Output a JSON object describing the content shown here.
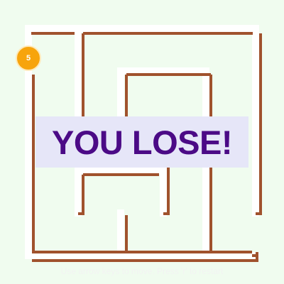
{
  "game": {
    "level_badge": "5",
    "result_banner": "YOU LOSE!",
    "instructions": "Use arrow keys to move. Press 'r' to restart"
  },
  "colors": {
    "background": "#f0fcef",
    "path": "#ffffff",
    "wall": "#a0522d",
    "badge": "#f7a40c",
    "banner_bg": "#e6e6f8",
    "banner_text": "#4b0a86"
  }
}
